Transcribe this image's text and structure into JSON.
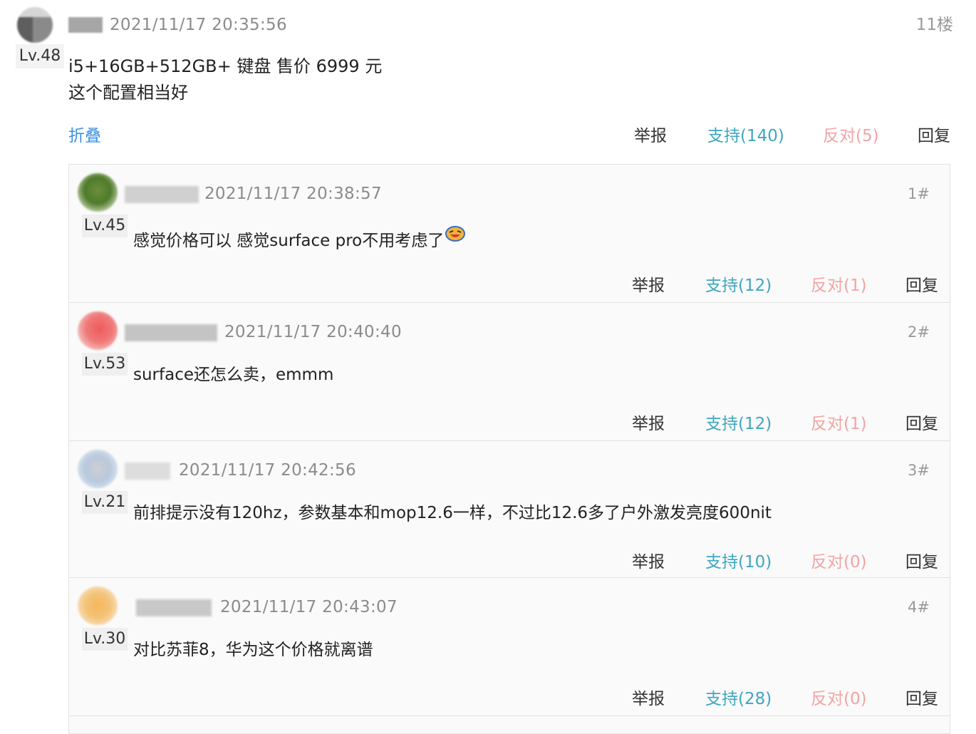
{
  "post": {
    "level": "Lv.48",
    "time": "2021/11/17 20:35:56",
    "floor": "11楼",
    "content_lines": [
      "i5+16GB+512GB+ 键盘 售价 6999 元",
      "这个配置相当好"
    ],
    "collapse_label": "折叠",
    "actions": {
      "report": "举报",
      "support": "支持(140)",
      "oppose": "反对(5)",
      "reply": "回复"
    }
  },
  "replies": [
    {
      "level": "Lv.45",
      "time": "2021/11/17 20:38:57",
      "floor": "1#",
      "text": "感觉价格可以 感觉surface pro不用考虑了",
      "has_emoji": true,
      "avatar_icon": "user-avatar-icon",
      "actions": {
        "report": "举报",
        "support": "支持(12)",
        "oppose": "反对(1)",
        "reply": "回复"
      }
    },
    {
      "level": "Lv.53",
      "time": "2021/11/17 20:40:40",
      "floor": "2#",
      "text": "surface还怎么卖，emmm",
      "actions": {
        "report": "举报",
        "support": "支持(12)",
        "oppose": "反对(1)",
        "reply": "回复"
      }
    },
    {
      "level": "Lv.21",
      "time": "2021/11/17 20:42:56",
      "floor": "3#",
      "text": "前排提示没有120hz，参数基本和mop12.6一样，不过比12.6多了户外激发亮度600nit",
      "actions": {
        "report": "举报",
        "support": "支持(10)",
        "oppose": "反对(0)",
        "reply": "回复"
      }
    },
    {
      "level": "Lv.30",
      "time": "2021/11/17 20:43:07",
      "floor": "4#",
      "text": "对比苏菲8，华为这个价格就离谱",
      "actions": {
        "report": "举报",
        "support": "支持(28)",
        "oppose": "反对(0)",
        "reply": "回复"
      }
    }
  ],
  "colors": {
    "support": "#3fa6bf",
    "oppose": "#f3a3a3",
    "link": "#3b8fe0",
    "meta": "#8b8b8b"
  }
}
